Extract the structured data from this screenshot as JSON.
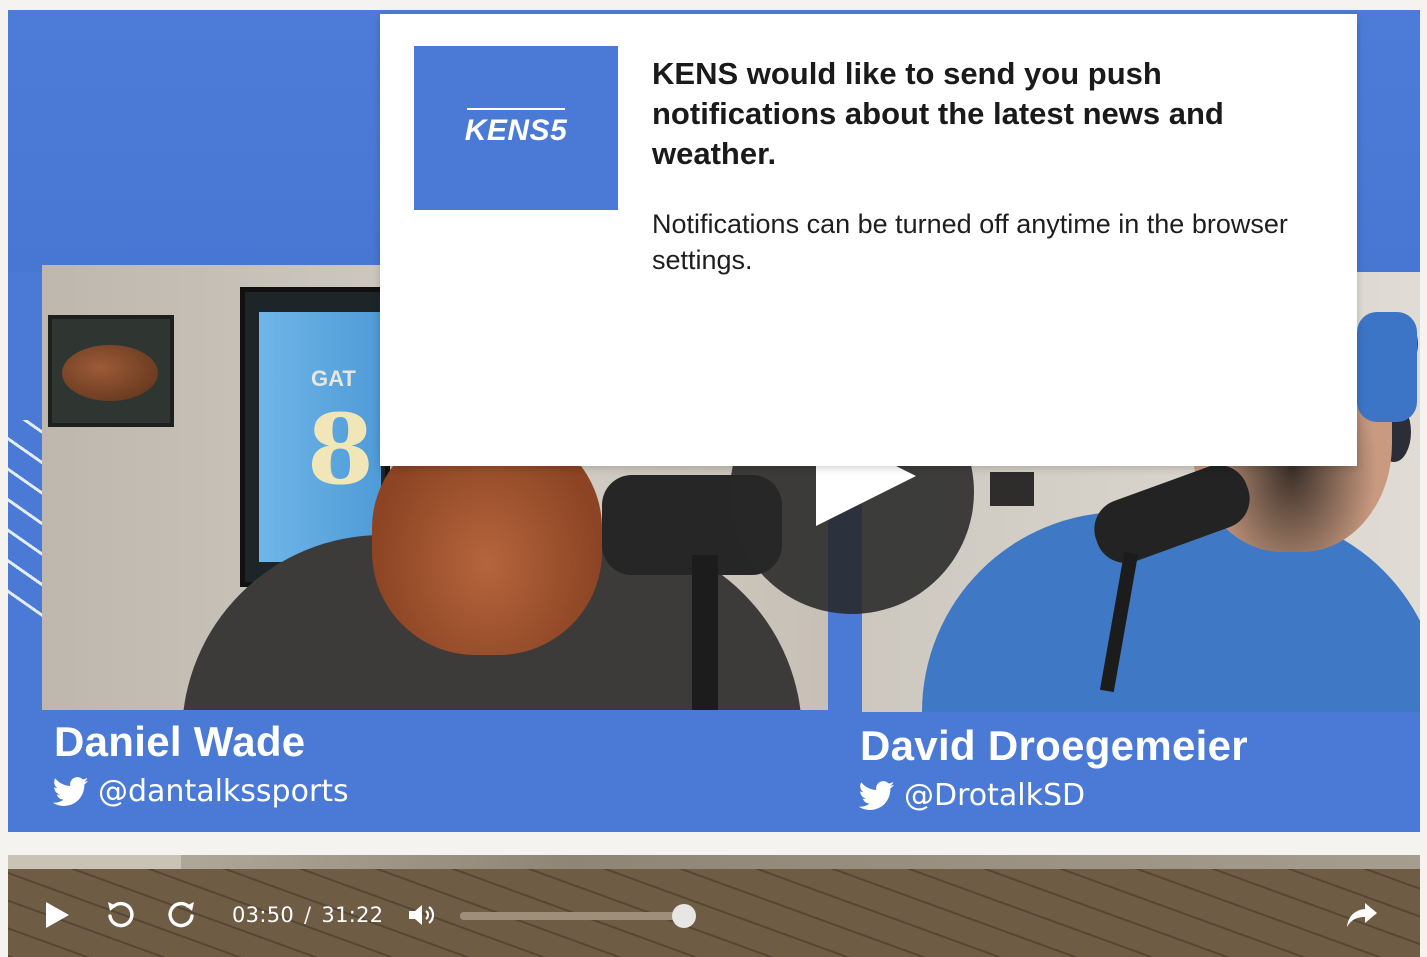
{
  "notification": {
    "logo_text": "KENS5",
    "title": "KENS would like to send you push notifications about the latest news and weather.",
    "body": "Notifications can be turned off anytime in the browser settings."
  },
  "video": {
    "hosts": [
      {
        "name": "Daniel Wade",
        "handle": "@dantalkssports"
      },
      {
        "name": "David Droegemeier",
        "handle": "@DrotalkSD"
      }
    ],
    "jersey_label": "GAT",
    "jersey_number": "8"
  },
  "player": {
    "current_time": "03:50",
    "separator": "/",
    "duration": "31:22",
    "played_fraction": 0.1225,
    "volume_fraction": 1.0,
    "icons": [
      "play-icon",
      "replay-icon",
      "forward-icon",
      "volume-icon",
      "share-icon"
    ]
  },
  "colors": {
    "brand_blue": "#4a7ad6",
    "popup_bg": "#ffffff",
    "controls_bg": "#6f5c45"
  }
}
